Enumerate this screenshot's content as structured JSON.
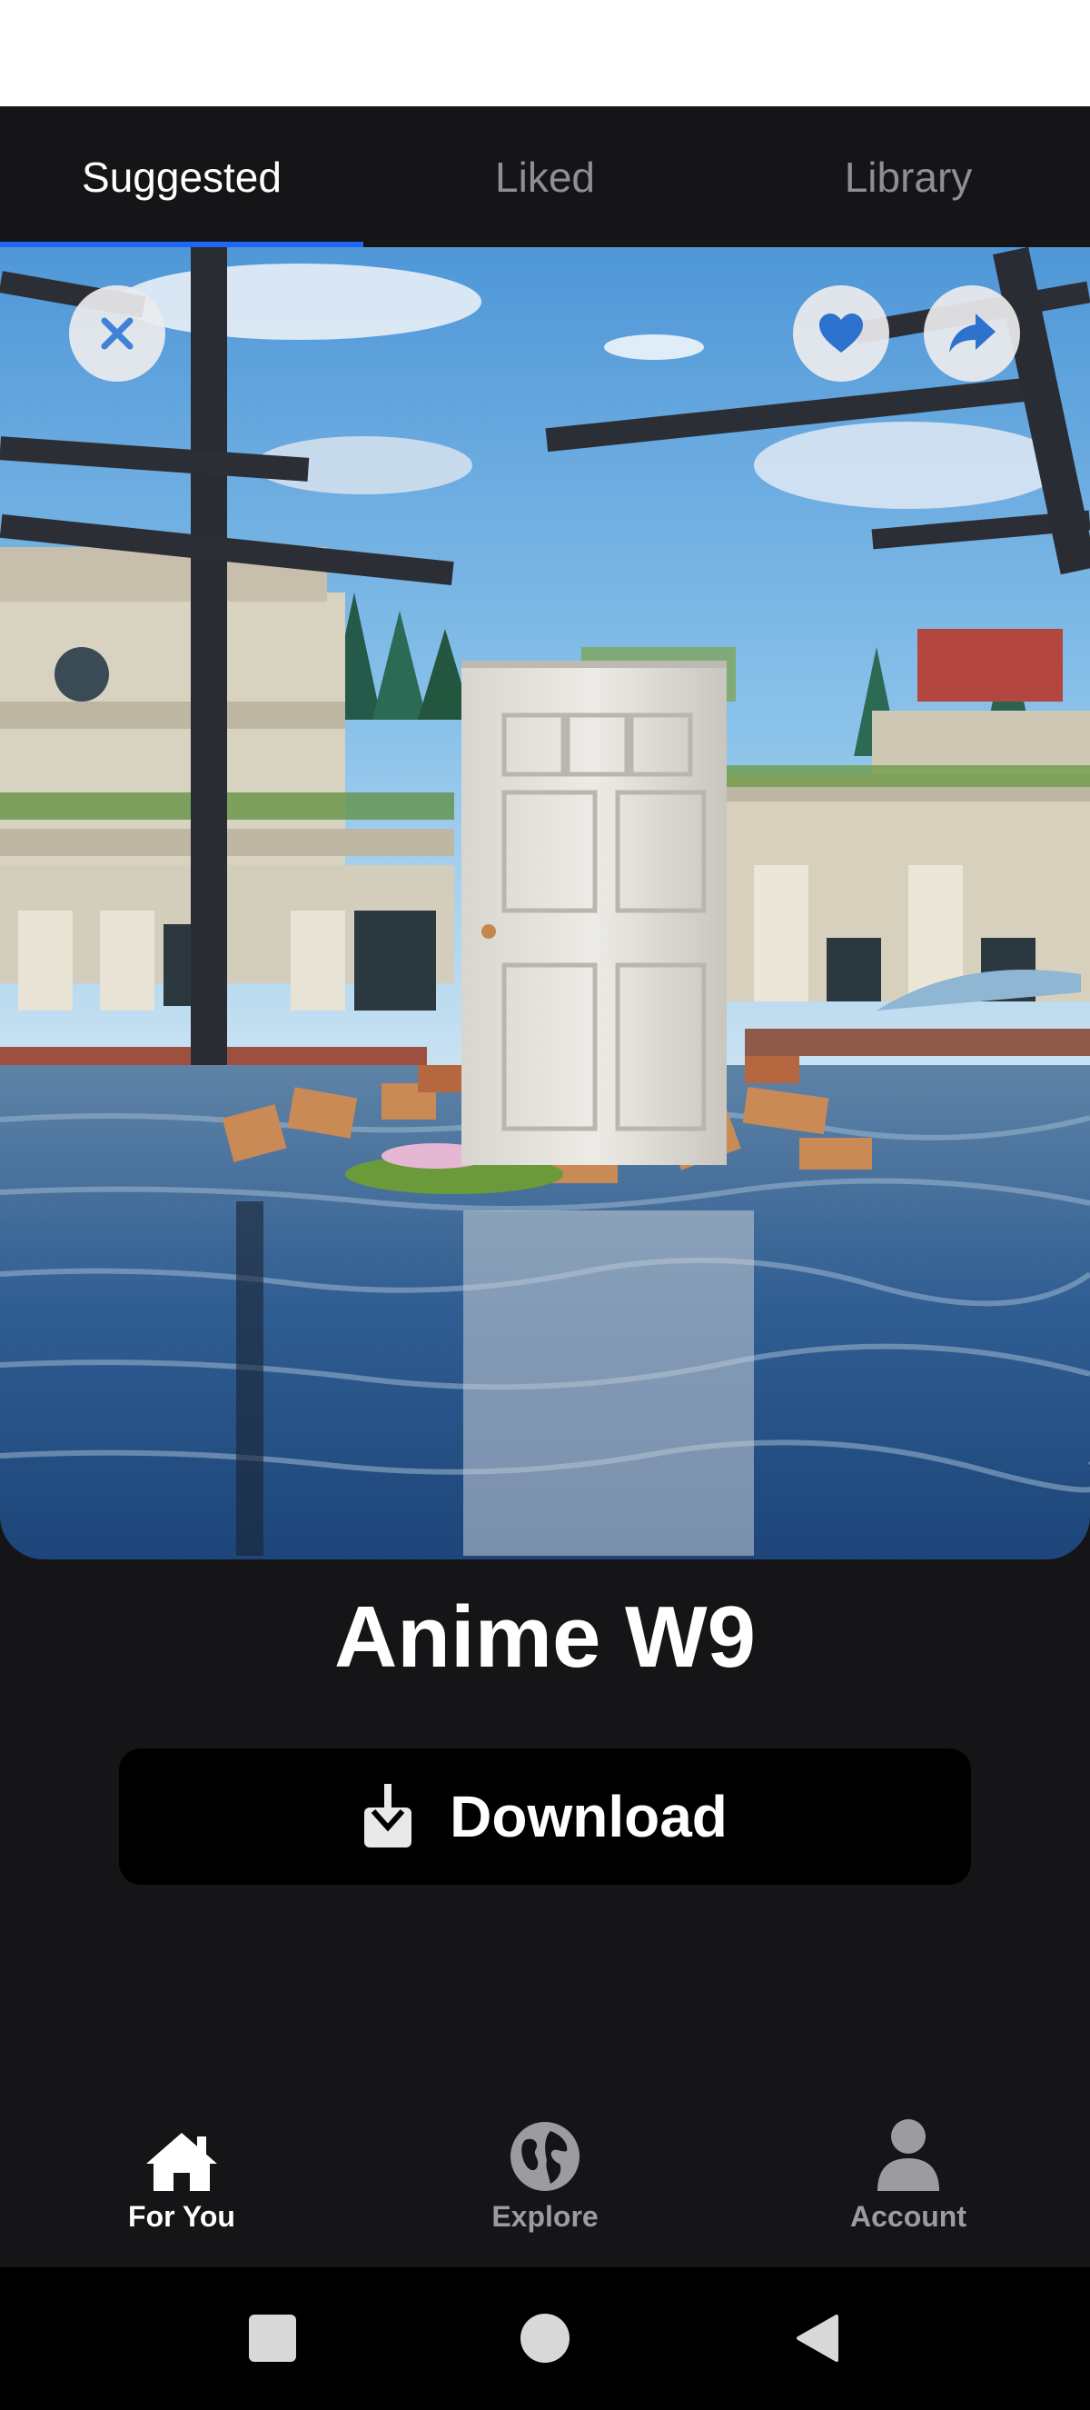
{
  "tabs": [
    {
      "label": "Suggested",
      "active": true
    },
    {
      "label": "Liked",
      "active": false
    },
    {
      "label": "Library",
      "active": false
    }
  ],
  "wallpaper": {
    "title": "Anime W9",
    "actions": {
      "close_icon": "close-icon",
      "like_icon": "heart-icon",
      "share_icon": "share-arrow-icon"
    }
  },
  "download": {
    "label": "Download",
    "icon": "download-icon"
  },
  "bottom_nav": [
    {
      "label": "For You",
      "icon": "home-icon",
      "active": true
    },
    {
      "label": "Explore",
      "icon": "globe-icon",
      "active": false
    },
    {
      "label": "Account",
      "icon": "user-icon",
      "active": false
    }
  ],
  "system_nav": {
    "recents_icon": "square-icon",
    "home_icon": "circle-icon",
    "back_icon": "triangle-back-icon"
  },
  "colors": {
    "background": "#151517",
    "tab_indicator": "#1e66f5",
    "button": "#000000",
    "text_primary": "#ffffff",
    "text_muted": "#8f8f93"
  }
}
